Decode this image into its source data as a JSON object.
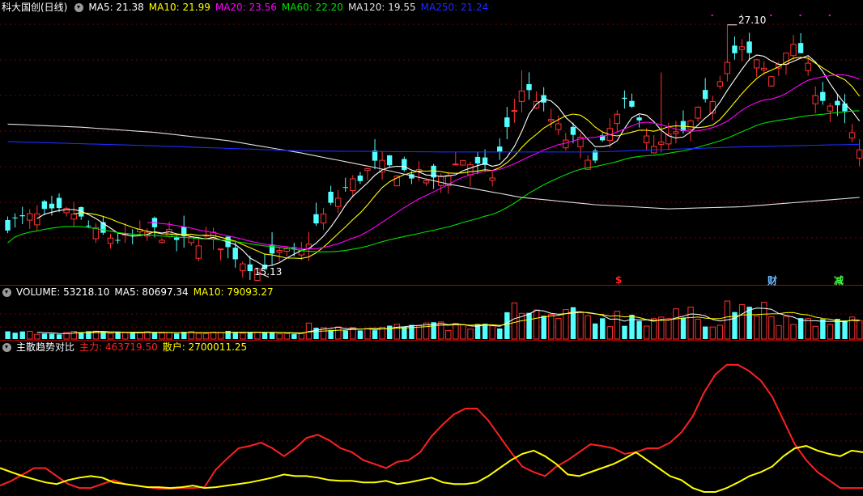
{
  "colors": {
    "up": "#ff3232",
    "down": "#54ffff",
    "grid": "#7a0000",
    "sep": "#c00000",
    "ma5": "#ffffff",
    "ma10": "#ffff00",
    "ma20": "#ff00ff",
    "ma60": "#00e000",
    "ma120": "#e0e0e0",
    "ma250": "#1c2cff",
    "label": "#ffffff",
    "zhuli": "#ff2020",
    "sanhu": "#ffff00",
    "sig_dollar": "#ff2020",
    "sig_cai": "#6fb8ff",
    "sig_jian": "#40ff40"
  },
  "main_panel": {
    "title": "科大国创(日线)",
    "indicators": [
      {
        "label": "MA5: 21.38",
        "color": "#ffffff"
      },
      {
        "label": "MA10: 21.99",
        "color": "#ffff00"
      },
      {
        "label": "MA20: 23.56",
        "color": "#ff00ff"
      },
      {
        "label": "MA60: 22.20",
        "color": "#00e000"
      },
      {
        "label": "MA120: 19.55",
        "color": "#e0e0e0"
      },
      {
        "label": "MA250: 21.24",
        "color": "#1c2cff"
      }
    ],
    "high_label": "27.10",
    "low_label": "15.13",
    "signals": [
      {
        "text": "$",
        "kind": "sig_dollar"
      },
      {
        "text": "财",
        "kind": "sig_cai"
      },
      {
        "text": "减",
        "kind": "sig_jian"
      }
    ]
  },
  "volume_panel": {
    "indicators": [
      {
        "label": "VOLUME: 53218.10",
        "color": "#ffffff"
      },
      {
        "label": "MA5: 80697.34",
        "color": "#ffffff"
      },
      {
        "label": "MA10: 79093.27",
        "color": "#ffff00"
      }
    ]
  },
  "trend_panel": {
    "title": "主散趋势对比",
    "indicators": [
      {
        "label": "主力: 463719.50",
        "color": "#ff2020"
      },
      {
        "label": "散户: 2700011.25",
        "color": "#ffff00"
      }
    ]
  },
  "chart_data": {
    "type": "line",
    "price_range": [
      14.6,
      27.6
    ],
    "candle_count": 117,
    "ma_keys": [
      {
        "key": "ma120",
        "color_key": "ma120",
        "values": [
          [
            0,
            22.3
          ],
          [
            10,
            22.15
          ],
          [
            20,
            21.9
          ],
          [
            30,
            21.5
          ],
          [
            40,
            20.9
          ],
          [
            50,
            20.2
          ],
          [
            60,
            19.4
          ],
          [
            70,
            18.75
          ],
          [
            80,
            18.4
          ],
          [
            90,
            18.2
          ],
          [
            100,
            18.3
          ],
          [
            116,
            18.75
          ]
        ]
      },
      {
        "key": "ma250",
        "color_key": "ma250",
        "values": [
          [
            0,
            21.45
          ],
          [
            20,
            21.25
          ],
          [
            40,
            21.0
          ],
          [
            60,
            20.95
          ],
          [
            80,
            20.95
          ],
          [
            100,
            21.2
          ],
          [
            116,
            21.32
          ]
        ]
      }
    ],
    "wave_series": [
      {
        "key": "zhuli",
        "values": [
          0.08,
          0.14,
          0.22,
          0.3,
          0.3,
          0.2,
          0.1,
          0.05,
          0.05,
          0.1,
          0.15,
          0.1,
          0.08,
          0.06,
          0.04,
          0.04,
          0.05,
          0.05,
          0.06,
          0.28,
          0.42,
          0.55,
          0.58,
          0.62,
          0.55,
          0.45,
          0.55,
          0.68,
          0.72,
          0.65,
          0.55,
          0.5,
          0.4,
          0.35,
          0.3,
          0.38,
          0.4,
          0.5,
          0.7,
          0.85,
          0.98,
          1.05,
          1.05,
          0.9,
          0.7,
          0.5,
          0.32,
          0.25,
          0.2,
          0.32,
          0.4,
          0.5,
          0.6,
          0.58,
          0.55,
          0.48,
          0.5,
          0.55,
          0.55,
          0.62,
          0.75,
          0.95,
          1.25,
          1.48,
          1.6,
          1.6,
          1.52,
          1.4,
          1.2,
          0.9,
          0.6,
          0.4,
          0.25,
          0.15,
          0.05,
          0.05,
          0.05
        ]
      },
      {
        "key": "sanhu",
        "values": [
          0.3,
          0.25,
          0.2,
          0.16,
          0.12,
          0.1,
          0.15,
          0.18,
          0.2,
          0.18,
          0.12,
          0.1,
          0.08,
          0.06,
          0.06,
          0.05,
          0.06,
          0.08,
          0.05,
          0.06,
          0.08,
          0.1,
          0.12,
          0.15,
          0.18,
          0.22,
          0.2,
          0.2,
          0.18,
          0.15,
          0.14,
          0.14,
          0.12,
          0.12,
          0.14,
          0.1,
          0.12,
          0.15,
          0.18,
          0.12,
          0.1,
          0.1,
          0.12,
          0.2,
          0.3,
          0.4,
          0.48,
          0.52,
          0.45,
          0.35,
          0.22,
          0.2,
          0.25,
          0.3,
          0.35,
          0.42,
          0.5,
          0.4,
          0.3,
          0.2,
          0.15,
          0.05,
          0.0,
          0.0,
          0.05,
          0.12,
          0.2,
          0.25,
          0.32,
          0.45,
          0.55,
          0.58,
          0.52,
          0.48,
          0.45,
          0.52,
          0.5
        ]
      }
    ]
  }
}
